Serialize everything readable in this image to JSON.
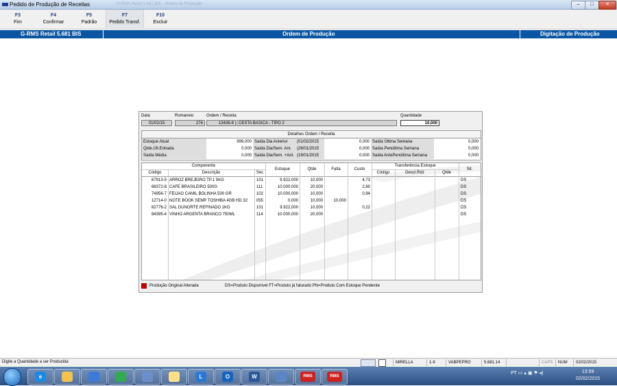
{
  "window": {
    "title": "Pedido de Produção de Receitas",
    "faded_title": "G-RMS Retail 5.681 BIS - Ordem de Produção",
    "controls": {
      "minimize": "–",
      "maximize": "□",
      "close": "✕"
    }
  },
  "fkeys": [
    {
      "key": "F3",
      "label": "Fim"
    },
    {
      "key": "F4",
      "label": "Confirmar"
    },
    {
      "key": "F5",
      "label": "Padrão"
    },
    {
      "key": "F7",
      "label": "Pedido Transf."
    },
    {
      "key": "F10",
      "label": "Excluir"
    }
  ],
  "header_bar": {
    "left": "G-RMS Retail 5.681 BIS",
    "center": "Ordem de Produção",
    "right": "Digitação de Produção"
  },
  "form": {
    "data_label": "Data",
    "data_value": "01/02/15",
    "romaneio_label": "Romaneio",
    "romaneio_value": "274",
    "ordem_label": "Ordem / Receita",
    "ordem_code": "13436-8",
    "ordem_desc": "CESTA BASICA - TIPO 2",
    "quantidade_label": "Quantidade",
    "quantidade_value": "10,000"
  },
  "details": {
    "title": "Detalhes Ordem / Receita",
    "rows": [
      {
        "l1": "Estoque Atual",
        "v1": "999,000",
        "l2": "Saída Dia Anterior",
        "d2": "(01/02/2015",
        "v2": "0,000",
        "l3": "Saída Última Semana",
        "v3": "0,000"
      },
      {
        "l1": "Qtde.Últ.Entrada",
        "v1": "0,000",
        "l2": "Saída Dia/Sem. Ant.",
        "d2": "(26/01/2015",
        "v2": "0,000",
        "l3": "Saída Penúltima Semana",
        "v3": "0,000"
      },
      {
        "l1": "Saída Média",
        "v1": "0,000",
        "l2": "Saída Dia/Sem. +Ant.",
        "d2": "(19/01/2015",
        "v2": "0,000",
        "l3": "Saída AntePenúltima Semana",
        "v3": "0,000"
      }
    ]
  },
  "grid": {
    "group_componente": "Componente",
    "group_transf": "Transferência Estoque",
    "headers": {
      "codigo": "Código",
      "descricao": "Descrição",
      "sec": "Sec",
      "estoque": "Estoque",
      "qtde": "Qtde",
      "falta": "Falta",
      "custo": "Custo",
      "t_codigo": "Código",
      "t_descr": "Descr.Rdz",
      "t_qtde": "Qtde",
      "sit": "Sit."
    },
    "rows": [
      {
        "codigo": "67913-5",
        "descricao": "ARROZ BREJEIRO TP.1 5KG",
        "sec": "101",
        "estoque": "9.922,000",
        "qtde": "10,000",
        "falta": "",
        "custo": "4,73",
        "sit": "DS"
      },
      {
        "codigo": "68372-8",
        "descricao": "CAFE BRASILEIRO 500G",
        "sec": "111",
        "estoque": "10.000,000",
        "qtde": "20,000",
        "falta": "",
        "custo": "2,60",
        "sit": "DS"
      },
      {
        "codigo": "74956-7",
        "descricao": "FEIJAO CAMIL BOLINHA 500 GR",
        "sec": "102",
        "estoque": "10.000,000",
        "qtde": "10,000",
        "falta": "",
        "custo": "0,94",
        "sit": "DS"
      },
      {
        "codigo": "12714-0",
        "descricao": "NOTE BOOK SEMP TOSHIBA 4GB HD 32",
        "sec": "055",
        "estoque": "0,000",
        "qtde": "10,000",
        "falta": "10,000",
        "custo": "",
        "sit": "DS"
      },
      {
        "codigo": "82776-2",
        "descricao": "SAL DUNORTE REFINADO 1KG",
        "sec": "101",
        "estoque": "9.922,000",
        "qtde": "10,000",
        "falta": "",
        "custo": "0,22",
        "sit": "DS"
      },
      {
        "codigo": "84395-4",
        "descricao": "VINHO ARGENTA BRANCO 750ML",
        "sec": "114",
        "estoque": "10.000,000",
        "qtde": "20,000",
        "falta": "",
        "custo": "",
        "sit": "DS"
      }
    ]
  },
  "legend": {
    "altered": "Produção Original Alterada",
    "codes": "DS=Produto Disponível  FT=Produto já faturado  PN=Produto Com Estoque Pendente",
    "altered_color": "#c00000"
  },
  "status": {
    "message": "Digite a Quantidade a ser Produzida",
    "user": "MIRELLA",
    "page": "1-9",
    "db": "VABPEPRO",
    "version": "5.681.14",
    "caps": "CAPS",
    "num": "NUM",
    "date": "02/02/2015"
  },
  "taskbar": {
    "apps": [
      {
        "icon": "internet-explorer-icon",
        "text": "e"
      },
      {
        "icon": "file-explorer-icon",
        "text": ""
      },
      {
        "icon": "media-player-icon",
        "text": ""
      },
      {
        "icon": "chrome-icon",
        "text": ""
      },
      {
        "icon": "remote-app-icon",
        "text": ""
      },
      {
        "icon": "sticky-notes-icon",
        "text": ""
      },
      {
        "icon": "lync-icon",
        "text": "L"
      },
      {
        "icon": "outlook-icon",
        "text": "O"
      },
      {
        "icon": "word-icon",
        "text": "W"
      },
      {
        "icon": "connection-icon",
        "text": ""
      },
      {
        "icon": "rms-app-icon",
        "text": "RMS"
      },
      {
        "icon": "rms-app-icon",
        "text": "RMS"
      }
    ],
    "language": "PT",
    "clock_time": "13:59",
    "clock_date": "02/02/2015"
  },
  "colors": {
    "header_blue": "#0a56a3",
    "fkey_blue": "#1f3a78"
  }
}
